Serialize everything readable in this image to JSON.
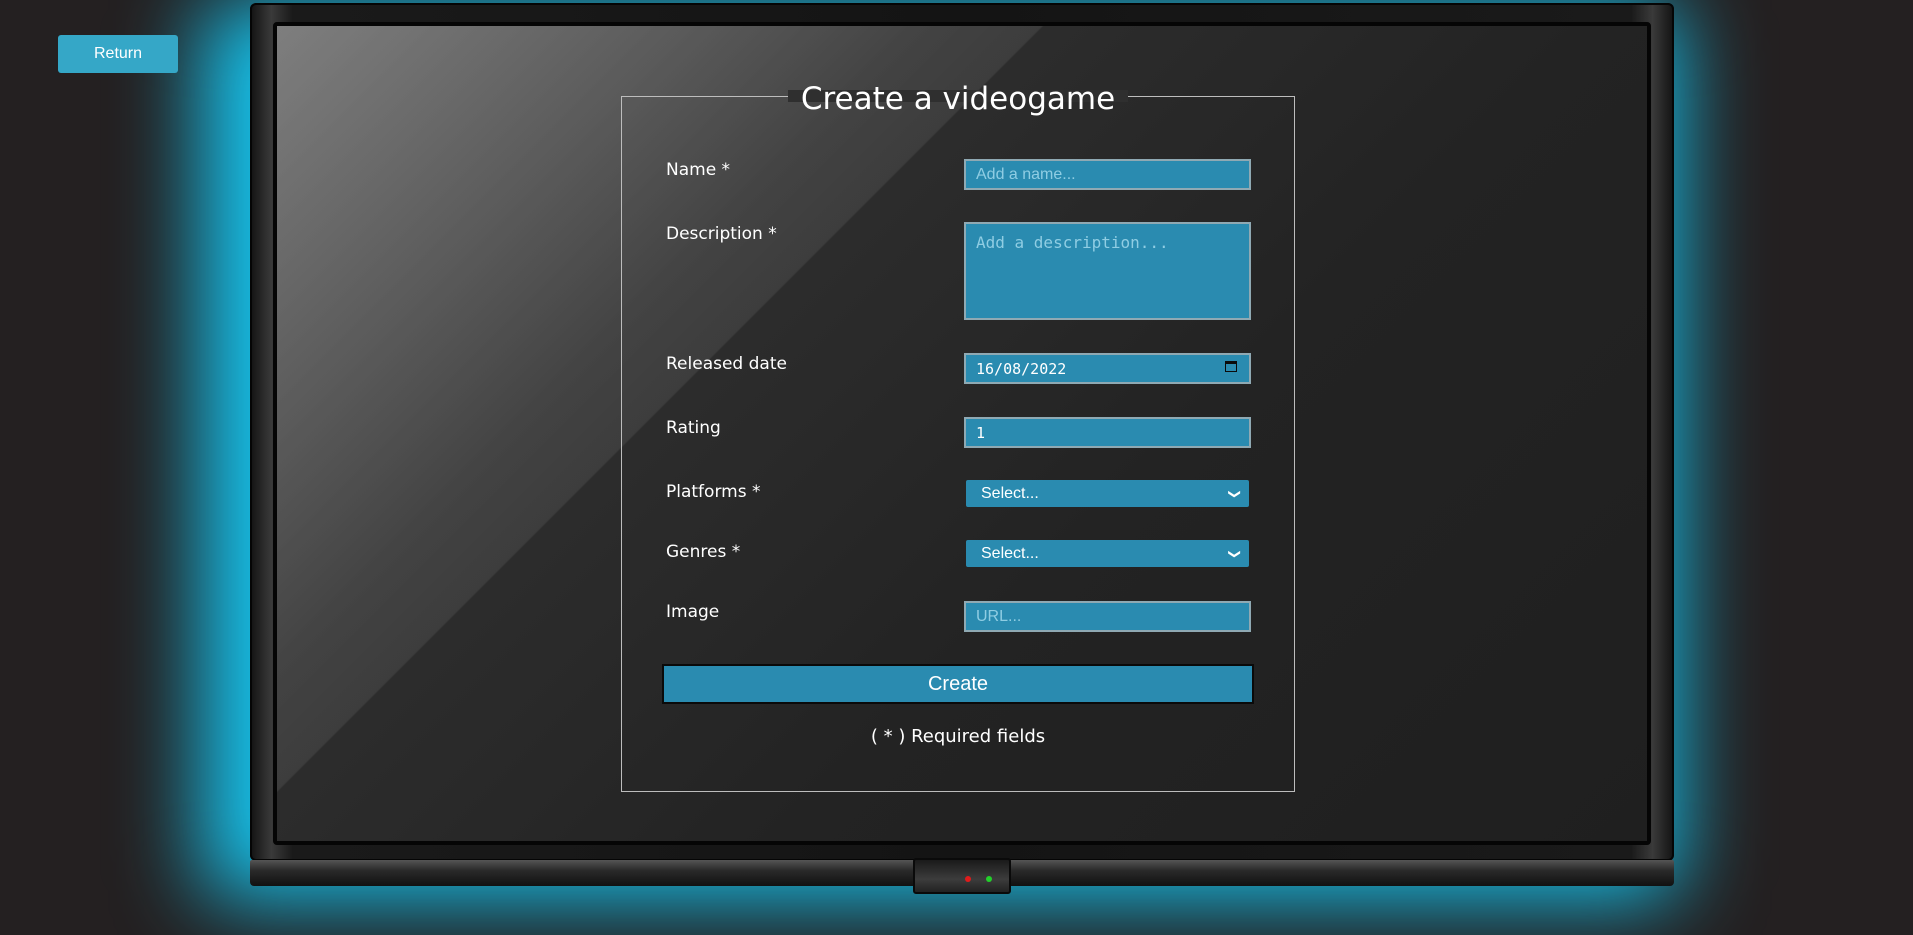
{
  "nav": {
    "return_label": "Return"
  },
  "form": {
    "title": "Create a videogame",
    "name": {
      "label": "Name *",
      "placeholder": "Add a name..."
    },
    "description": {
      "label": "Description *",
      "placeholder": "Add a description..."
    },
    "released": {
      "label": "Released date",
      "value": "16/08/2022"
    },
    "rating": {
      "label": "Rating",
      "value": "1"
    },
    "platforms": {
      "label": "Platforms *",
      "selected": "Select..."
    },
    "genres": {
      "label": "Genres *",
      "selected": "Select..."
    },
    "image": {
      "label": "Image",
      "placeholder": "URL..."
    },
    "submit_label": "Create",
    "required_note": "( * ) Required fields"
  },
  "colors": {
    "background": "#242021",
    "glow": "#14d2ff",
    "field": "#2a8bb0",
    "return_button": "#35a7c7"
  },
  "icons": {
    "calendar": "calendar-icon",
    "dropdown": "chevron-down-icon"
  }
}
